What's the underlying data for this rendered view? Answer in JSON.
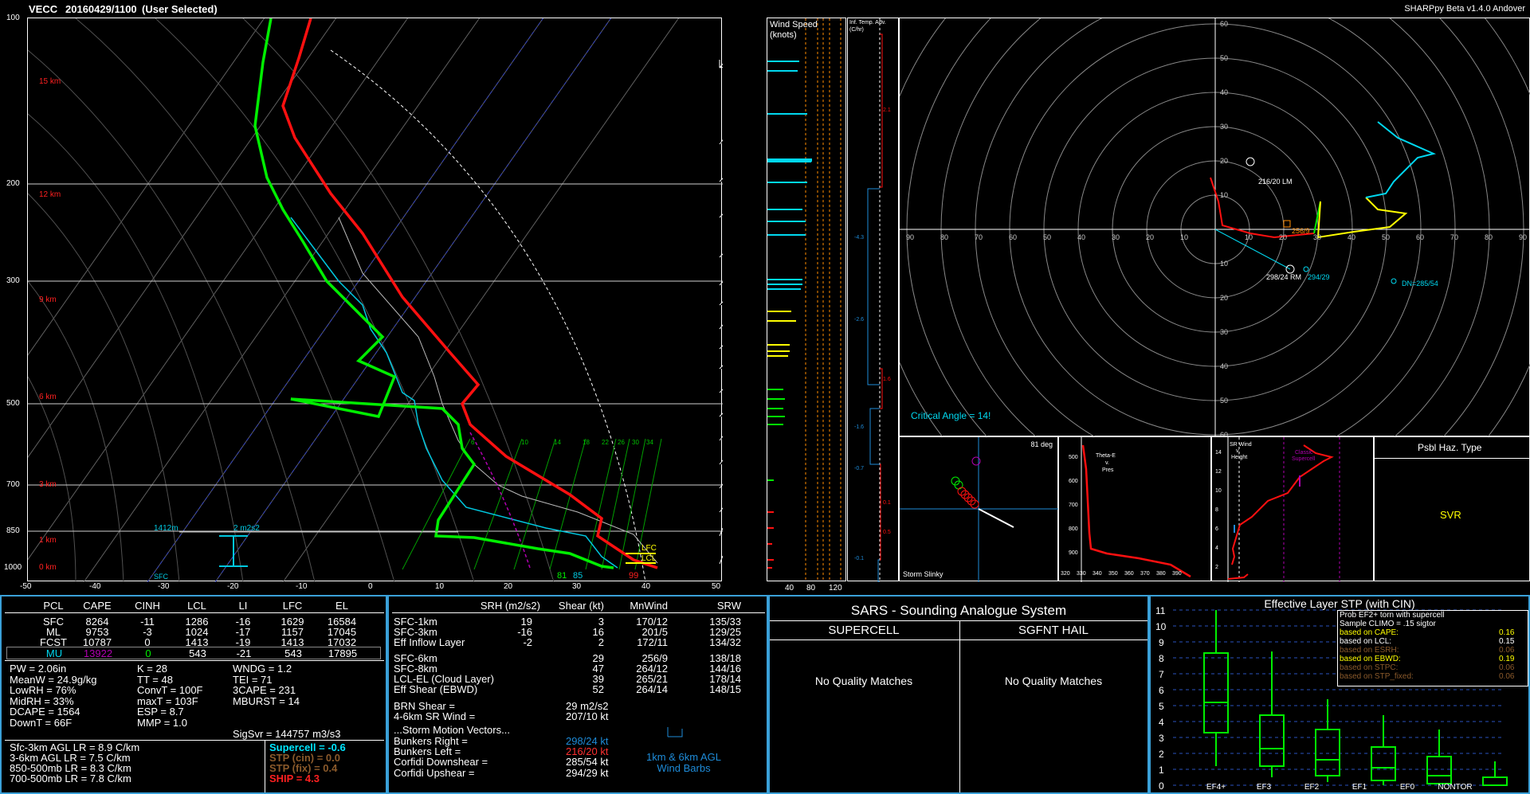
{
  "header": {
    "station": "VECC",
    "datetime": "20160429/1100",
    "mode": "(User Selected)",
    "version": "SHARPpy Beta v1.4.0 Andover"
  },
  "skewt": {
    "pressure_labels": [
      "100",
      "200",
      "300",
      "500",
      "700",
      "850",
      "1000"
    ],
    "height_labels": [
      "15 km",
      "12 km",
      "9 km",
      "6 km",
      "3 km",
      "1 km",
      "0 km"
    ],
    "temp_ticks": [
      "-50",
      "-40",
      "-30",
      "-20",
      "-10",
      "0",
      "10",
      "20",
      "30",
      "40",
      "50"
    ],
    "mixing_ratios": [
      "6",
      "10",
      "14",
      "18",
      "22",
      "26",
      "30",
      "34"
    ],
    "annotations": {
      "eff_height": "1412m",
      "eff_srh": "2 m2s2",
      "sfc": "SFC",
      "lfc": "LFC",
      "lcl": "LCL",
      "td_sfc": "81",
      "wb_sfc": "85",
      "t_sfc": "99"
    }
  },
  "wind_speed": {
    "title_line1": "Wind Speed",
    "title_line2": "(knots)",
    "ticks": [
      "40",
      "80",
      "120"
    ]
  },
  "inferred_temp": {
    "title_line1": "Inf. Temp. Adv.",
    "title_line2": "(C/hr)",
    "values": [
      "2.1",
      "-4.3",
      "-2.6",
      "1.6",
      "-1.6",
      "-0.7",
      "0.1",
      "0.5",
      "-0.1"
    ]
  },
  "hodograph": {
    "x_ticks_left": [
      "90",
      "80",
      "70",
      "60",
      "50",
      "40",
      "30",
      "20",
      "10"
    ],
    "x_ticks_right": [
      "10",
      "20",
      "30",
      "40",
      "50",
      "60",
      "70",
      "80",
      "90"
    ],
    "y_ticks_up": [
      "60",
      "50",
      "40",
      "30",
      "20",
      "10"
    ],
    "y_ticks_down": [
      "10",
      "20",
      "30",
      "40",
      "50",
      "60"
    ],
    "labels": {
      "lm": "216/20 LM",
      "rm": "298/24 RM",
      "ewind": "294/29",
      "dn": "DN=285/54",
      "mean": "256/9",
      "critical_angle": "Critical Angle = 14!"
    }
  },
  "storm_slinky": {
    "title": "Storm Slinky",
    "angle": "81 deg"
  },
  "theta_e": {
    "title1": "Theta-E",
    "title2": "v.",
    "title3": "Pres",
    "y_ticks": [
      "500",
      "600",
      "700",
      "800",
      "900"
    ],
    "x_ticks": [
      "320",
      "330",
      "340",
      "350",
      "360",
      "370",
      "380",
      "390"
    ]
  },
  "srwind": {
    "title1": "SR Wind",
    "title2": "v.",
    "title3": "Height",
    "title4": "Classic",
    "title5": "Supercell",
    "y_ticks": [
      "14",
      "12",
      "10",
      "8",
      "6",
      "4",
      "2"
    ]
  },
  "hazard": {
    "title": "Psbl Haz. Type",
    "value": "SVR"
  },
  "parcel_table": {
    "headers": [
      "PCL",
      "CAPE",
      "CINH",
      "LCL",
      "LI",
      "LFC",
      "EL"
    ],
    "rows": [
      [
        "SFC",
        "8264",
        "-11",
        "1286",
        "-16",
        "1629",
        "16584"
      ],
      [
        "ML",
        "9753",
        "-3",
        "1024",
        "-17",
        "1157",
        "17045"
      ],
      [
        "FCST",
        "10787",
        "0",
        "1413",
        "-19",
        "1413",
        "17032"
      ],
      [
        "MU",
        "13922",
        "0",
        "543",
        "-21",
        "543",
        "17895"
      ]
    ]
  },
  "indices": {
    "col1": [
      "PW = 2.06in",
      "MeanW = 24.9g/kg",
      "LowRH = 76%",
      "MidRH = 33%",
      "DCAPE = 1564",
      "DownT = 66F"
    ],
    "col2": [
      "K = 28",
      "TT = 48",
      "ConvT = 100F",
      "maxT = 103F",
      "ESP = 8.7",
      "MMP = 1.0"
    ],
    "col3": [
      "WNDG = 1.2",
      "TEI = 71",
      "3CAPE = 231",
      "MBURST = 14",
      "",
      ""
    ],
    "sigsvr": "SigSvr = 144757 m3/s3"
  },
  "lapse_rates": [
    "Sfc-3km AGL LR = 8.9 C/km",
    "3-6km AGL LR = 7.5 C/km",
    "850-500mb LR = 8.3 C/km",
    "700-500mb LR = 7.8 C/km"
  ],
  "composites": [
    {
      "label": "Supercell = -0.6",
      "color": "#00e5ff"
    },
    {
      "label": "STP (cin) = 0.0",
      "color": "#8b5a2b"
    },
    {
      "label": "STP (fix) = 0.4",
      "color": "#8b5a2b"
    },
    {
      "label": "SHIP = 4.3",
      "color": "#ff2020"
    }
  ],
  "kinematics": {
    "headers": [
      "SRH (m2/s2)",
      "Shear (kt)",
      "MnWind",
      "SRW"
    ],
    "rows": [
      [
        "SFC-1km",
        "19",
        "3",
        "170/12",
        "135/33"
      ],
      [
        "SFC-3km",
        "-16",
        "16",
        "201/5",
        "129/25"
      ],
      [
        "Eff Inflow Layer",
        "-2",
        "2",
        "172/11",
        "134/32"
      ],
      [
        "SFC-6km",
        "",
        "29",
        "256/9",
        "138/18"
      ],
      [
        "SFC-8km",
        "",
        "47",
        "264/12",
        "144/16"
      ],
      [
        "LCL-EL (Cloud Layer)",
        "",
        "39",
        "265/21",
        "178/14"
      ],
      [
        "Eff Shear (EBWD)",
        "",
        "52",
        "264/14",
        "148/15"
      ]
    ],
    "brn_label": "BRN Shear =",
    "brn_value": "29 m2/s2",
    "sr46_label": "4-6km SR Wind =",
    "sr46_value": "207/10 kt",
    "storm_motion_title": "...Storm Motion Vectors...",
    "motions": [
      {
        "label": "Bunkers Right =",
        "value": "298/24 kt",
        "color": "#1e8bd8"
      },
      {
        "label": "Bunkers Left =",
        "value": "216/20 kt",
        "color": "#ff3030"
      },
      {
        "label": "Corfidi Downshear =",
        "value": "285/54 kt",
        "color": "#ffffff"
      },
      {
        "label": "Corfidi Upshear =",
        "value": "294/29 kt",
        "color": "#ffffff"
      }
    ],
    "barb_caption1": "1km & 6km AGL",
    "barb_caption2": "Wind Barbs"
  },
  "sars": {
    "title": "SARS - Sounding Analogue System",
    "supercell_header": "SUPERCELL",
    "hail_header": "SGFNT HAIL",
    "supercell_result": "No Quality Matches",
    "hail_result": "No Quality Matches"
  },
  "stp": {
    "title": "Effective Layer STP (with CIN)",
    "y_ticks": [
      "11",
      "10",
      "9",
      "8",
      "7",
      "6",
      "5",
      "4",
      "3",
      "2",
      "1",
      "0"
    ],
    "categories": [
      "EF4+",
      "EF3",
      "EF2",
      "EF1",
      "EF0",
      "NONTOR"
    ],
    "legend_title1": "Prob EF2+ torn with supercell",
    "legend_title2": "Sample CLIMO = .15 sigtor",
    "legend_rows": [
      {
        "label": "based on CAPE:",
        "value": "0.16",
        "color": "#ffff00"
      },
      {
        "label": "based on LCL:",
        "value": "0.15",
        "color": "#ffffff"
      },
      {
        "label": "based on ESRH:",
        "value": "0.06",
        "color": "#8b5a2b"
      },
      {
        "label": "based on EBWD:",
        "value": "0.19",
        "color": "#ffff00"
      },
      {
        "label": "based on STPC:",
        "value": "0.06",
        "color": "#8b5a2b"
      },
      {
        "label": "based on STP_fixed:",
        "value": "0.06",
        "color": "#8b5a2b"
      }
    ]
  },
  "chart_data": {
    "type": "box",
    "title": "Effective Layer STP (with CIN)",
    "categories": [
      "EF4+",
      "EF3",
      "EF2",
      "EF1",
      "EF0",
      "NONTOR"
    ],
    "ylim": [
      0,
      11
    ],
    "boxes": [
      {
        "name": "EF4+",
        "whisker_low": 1.2,
        "q1": 3.3,
        "median": 5.2,
        "q3": 8.3,
        "whisker_high": 11.0
      },
      {
        "name": "EF3",
        "whisker_low": 0.5,
        "q1": 1.2,
        "median": 2.3,
        "q3": 4.4,
        "whisker_high": 8.4
      },
      {
        "name": "EF2",
        "whisker_low": 0.2,
        "q1": 0.6,
        "median": 1.6,
        "q3": 3.5,
        "whisker_high": 5.4
      },
      {
        "name": "EF1",
        "whisker_low": 0.0,
        "q1": 0.3,
        "median": 1.1,
        "q3": 2.4,
        "whisker_high": 4.4
      },
      {
        "name": "EF0",
        "whisker_low": 0.0,
        "q1": 0.1,
        "median": 0.6,
        "q3": 1.8,
        "whisker_high": 3.5
      },
      {
        "name": "NONTOR",
        "whisker_low": 0.0,
        "q1": 0.0,
        "median": 0.0,
        "q3": 0.5,
        "whisker_high": 1.5
      }
    ]
  }
}
